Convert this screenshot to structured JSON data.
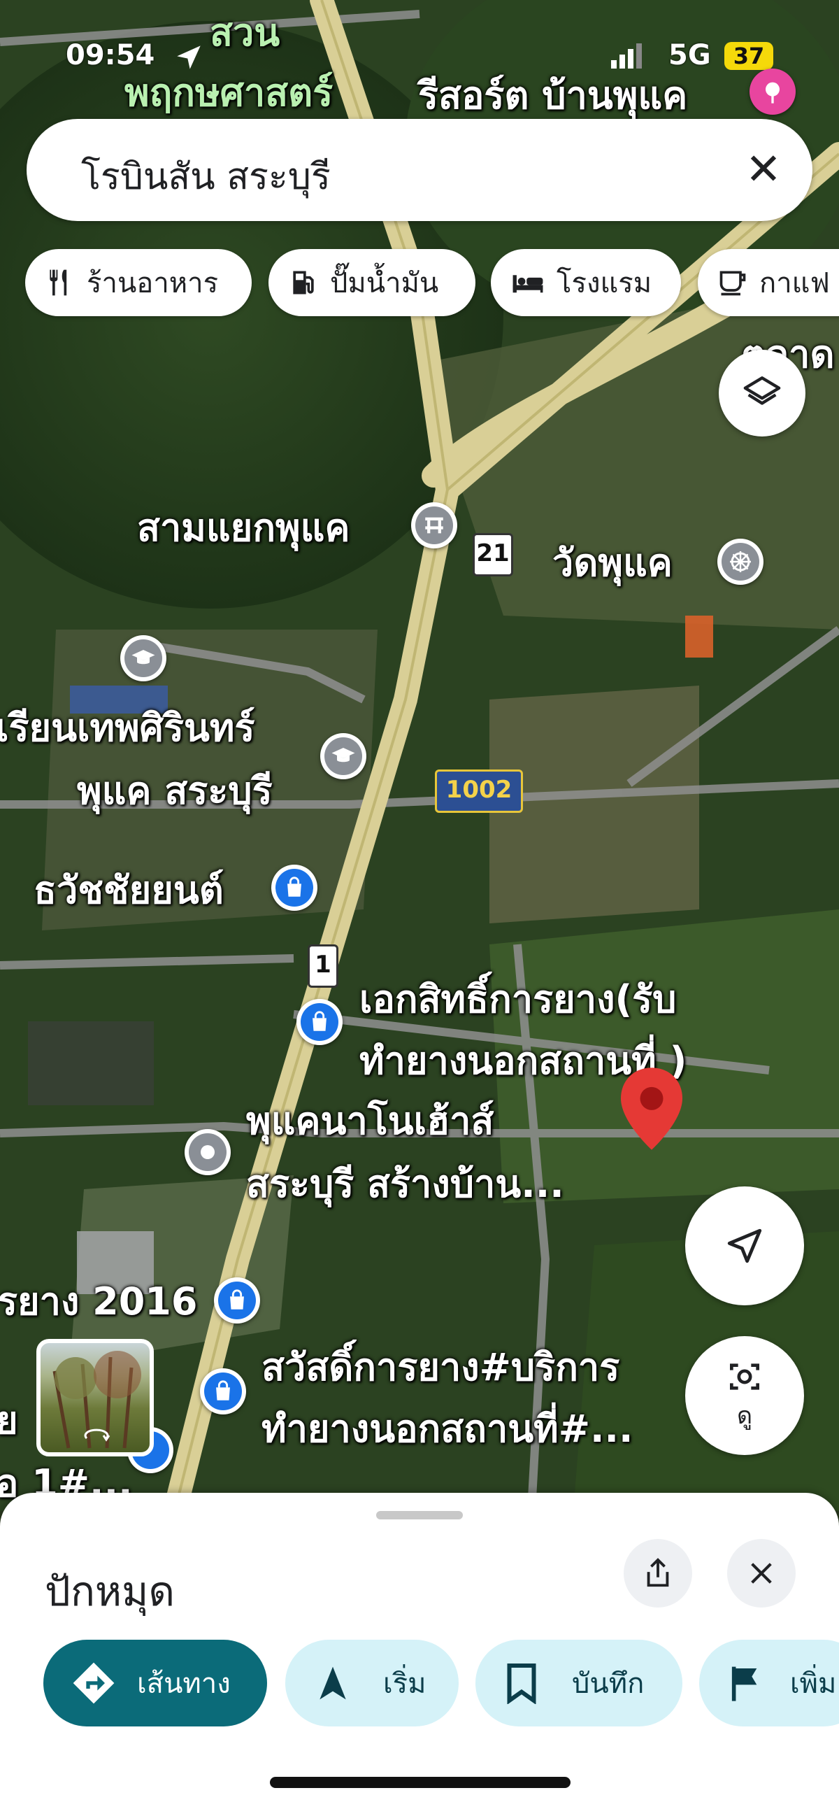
{
  "status_bar": {
    "time": "09:54",
    "network": "5G",
    "battery": "37"
  },
  "search": {
    "query": "โรบินสัน สระบุรี",
    "close_glyph": "✕"
  },
  "chips": [
    {
      "label": "ร้านอาหาร",
      "icon": "restaurant-icon"
    },
    {
      "label": "ปั๊มน้ำมัน",
      "icon": "gas-station-icon"
    },
    {
      "label": "โรงแรม",
      "icon": "hotel-bed-icon"
    },
    {
      "label": "กาแฟ",
      "icon": "coffee-cup-icon"
    }
  ],
  "map_labels": {
    "garden_line1": "สวน",
    "garden_line2": "พฤกษศาสตร์",
    "resort": "รีสอร์ต บ้านพุแค",
    "market_partial": "ตลาด",
    "junction": "สามแยกพุแค",
    "temple": "วัดพุแค",
    "school_line1": "เรียนเทพศิรินทร์",
    "school_line2": "พุแค สระบุรี",
    "shop1": "ธวัชชัยยนต์",
    "shop2_line1": "เอกสิทธิ์การยาง(รับ",
    "shop2_line2": "ทำยางนอกสถานที่ )",
    "house_line1": "พุแคนาโนเฮ้าส์",
    "house_line2": "สระบุรี สร้างบ้าน...",
    "tyre_partial": "รยาง 2016",
    "shop3_line1": "สวัสดิ์การยาง#บริการ",
    "shop3_line2": "ทำยางนอกสถานที่#...",
    "left_partial_1": "ย",
    "left_partial_2": "อ 1#..."
  },
  "road_shields": {
    "route_21": "21",
    "route_1002": "1002",
    "route_1": "1"
  },
  "fab": {
    "street_view_label": "ดู"
  },
  "sheet": {
    "title": "ปักหมุด",
    "actions": [
      {
        "label": "เส้นทาง"
      },
      {
        "label": "เริ่ม"
      },
      {
        "label": "บันทึก"
      },
      {
        "label": "เพิ่ม"
      }
    ]
  },
  "colors": {
    "primary": "#0b6b79",
    "action_light": "#d5f2f8",
    "pin_red": "#e53935",
    "poi_blue": "#1a73e8",
    "poi_gray": "#8a8f96"
  }
}
